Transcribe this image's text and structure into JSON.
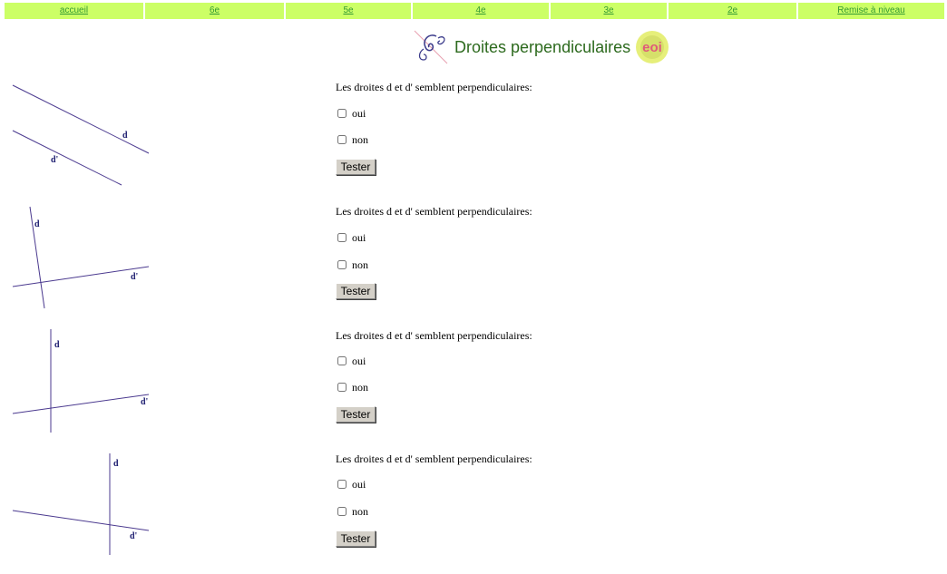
{
  "nav": [
    {
      "label": "accueil"
    },
    {
      "label": "6e"
    },
    {
      "label": "5e"
    },
    {
      "label": "4e"
    },
    {
      "label": "3e"
    },
    {
      "label": "2e"
    },
    {
      "label": "Remise à niveau"
    }
  ],
  "title": "Droites perpendiculaires",
  "logo_text": "eoi",
  "colors": {
    "nav_bg": "#ccff66",
    "nav_link": "#339933",
    "title": "#2d6a1e",
    "line": "#4b3a8f",
    "label": "#1a1a6e"
  },
  "exercises": [
    {
      "question": "Les droites d et d' semblent perpendiculaires:",
      "opt_yes": "oui",
      "opt_no": "non",
      "button": "Tester",
      "label_d": "d",
      "label_d2": "d'"
    },
    {
      "question": "Les droites d et d' semblent perpendiculaires:",
      "opt_yes": "oui",
      "opt_no": "non",
      "button": "Tester",
      "label_d": "d",
      "label_d2": "d'"
    },
    {
      "question": "Les droites d et d' semblent perpendiculaires:",
      "opt_yes": "oui",
      "opt_no": "non",
      "button": "Tester",
      "label_d": "d",
      "label_d2": "d'"
    },
    {
      "question": "Les droites d et d' semblent perpendiculaires:",
      "opt_yes": "oui",
      "opt_no": "non",
      "button": "Tester",
      "label_d": "d",
      "label_d2": "d'"
    }
  ]
}
